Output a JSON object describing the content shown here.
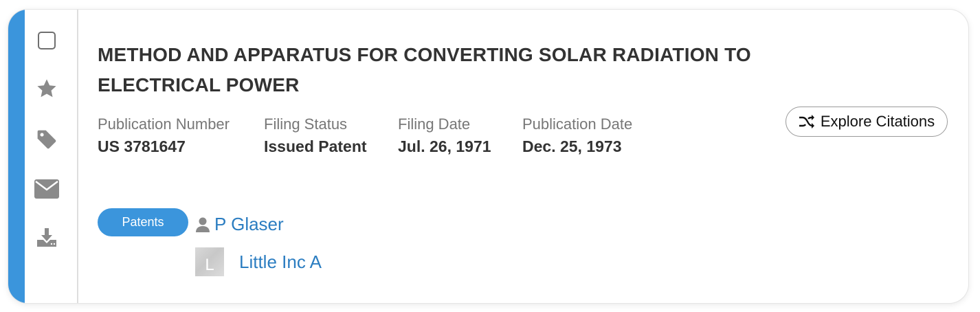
{
  "title": "METHOD AND APPARATUS FOR CONVERTING SOLAR RADIATION TO ELECTRICAL POWER",
  "meta": {
    "publication_number": {
      "label": "Publication Number",
      "value": "US 3781647"
    },
    "filing_status": {
      "label": "Filing Status",
      "value": "Issued Patent"
    },
    "filing_date": {
      "label": "Filing Date",
      "value": "Jul. 26, 1971"
    },
    "publication_date": {
      "label": "Publication Date",
      "value": "Dec. 25, 1973"
    }
  },
  "explore_citations": {
    "label": "Explore Citations",
    "icon": "shuffle-icon"
  },
  "type_badge": "Patents",
  "inventor": {
    "name": "P Glaser",
    "icon": "person-icon"
  },
  "assignee": {
    "name": "Little Inc A",
    "avatar_letter": "L"
  },
  "toolbar": {
    "icons": [
      "checkbox-icon",
      "star-icon",
      "tag-icon",
      "envelope-icon",
      "download-icon"
    ]
  },
  "colors": {
    "accent": "#3b95dc",
    "link": "#2b7dc1",
    "icon_gray": "#8a8a8a",
    "title_text": "#333333",
    "label_text": "#777777"
  }
}
